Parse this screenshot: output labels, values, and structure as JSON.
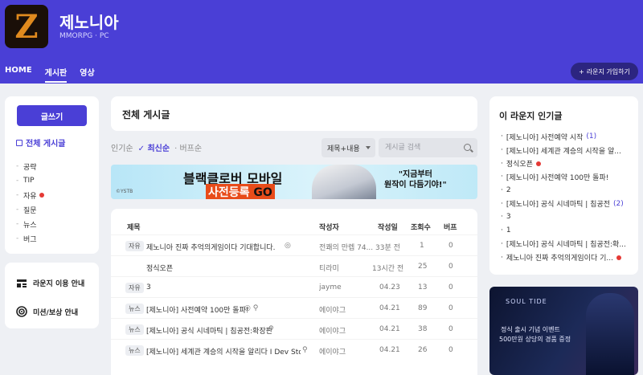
{
  "header": {
    "title": "제노니아",
    "subtitle": "MMORPG · PC",
    "logo_letter": "Z",
    "nav": [
      {
        "label": "HOME",
        "active": false
      },
      {
        "label": "게시판",
        "active": true
      },
      {
        "label": "영상",
        "active": false
      }
    ],
    "join_button": "라운지 가입하기",
    "join_icon": "+"
  },
  "sidebar": {
    "write_button": "글쓰기",
    "all_posts": "전체 게시글",
    "categories": [
      {
        "label": "공략",
        "new": false
      },
      {
        "label": "TIP",
        "new": false
      },
      {
        "label": "자유",
        "new": true
      },
      {
        "label": "질문",
        "new": false
      },
      {
        "label": "뉴스",
        "new": false
      },
      {
        "label": "버그",
        "new": false
      }
    ],
    "guides": [
      "라운지 이용 안내",
      "미션/보상 안내"
    ]
  },
  "main": {
    "title": "전체 게시글",
    "sort": {
      "popular": "인기순",
      "latest": "최신순",
      "recommended": "버프순",
      "active_check": "✓"
    },
    "search": {
      "filter": "제목+내용",
      "placeholder": "게시글 검색"
    },
    "banner": {
      "line1": "블랙클로버 모바일",
      "line2_a": "사전등록",
      "line2_b": "GO",
      "quote1": "\"지금부터",
      "quote2": "원작이 다듬기야!\"",
      "age": "©YSTB"
    },
    "table": {
      "headers": [
        "제목",
        "작성자",
        "작성일",
        "조회수",
        "버프"
      ],
      "rows": [
        {
          "tag": "자유",
          "title": "제노니아 진짜 추억의게임이다 기대합니다.",
          "author": "전쾌의 만렙 74...",
          "date": "33분 전",
          "views": "1",
          "buff": "0"
        },
        {
          "tag": "",
          "title": "정식오픈",
          "author": "티라미",
          "date": "13시간 전",
          "views": "25",
          "buff": "0"
        },
        {
          "tag": "자유",
          "title": "3",
          "author": "jayme",
          "date": "04.23",
          "views": "13",
          "buff": "0"
        },
        {
          "tag": "뉴스",
          "title": "[제노니아] 사전예약 100만 돌파!",
          "author": "에이야그",
          "date": "04.21",
          "views": "89",
          "buff": "0"
        },
        {
          "tag": "뉴스",
          "title": "[제노니아] 공식 시네마틱 | 침공전:확장판",
          "author": "에이야그",
          "date": "04.21",
          "views": "38",
          "buff": "0"
        },
        {
          "tag": "뉴스",
          "title": "[제노니아] 세계관 계승의 시작을 알리다 I Dev Story",
          "author": "에이야그",
          "date": "04.21",
          "views": "26",
          "buff": "0"
        }
      ]
    }
  },
  "popular": {
    "title": "이 라운지 인기글",
    "items": [
      {
        "label": "[제노니아] 사전예약 시작",
        "count": "(1)",
        "new": false
      },
      {
        "label": "[제노니아] 세계관 계승의 시작을 알...",
        "count": "",
        "new": false
      },
      {
        "label": "정식오픈",
        "count": "",
        "new": true
      },
      {
        "label": "[제노니아] 사전예약 100만 돌파!",
        "count": "",
        "new": false
      },
      {
        "label": "2",
        "count": "",
        "new": false
      },
      {
        "label": "[제노니아] 공식 시네마틱 | 침공전",
        "count": "(2)",
        "new": false
      },
      {
        "label": "3",
        "count": "",
        "new": false
      },
      {
        "label": "1",
        "count": "",
        "new": false
      },
      {
        "label": "[제노니아] 공식 시네마틱 | 침공전:확...",
        "count": "",
        "new": false
      },
      {
        "label": "제노니아 진짜 추억의게임이다 기...",
        "count": "",
        "new": true
      }
    ]
  },
  "ad": {
    "logo": "SOUL TIDE",
    "line1": "정식 출시 기념 이벤트",
    "line2": "500만원 상당의 경품 증정"
  },
  "colors": {
    "accent": "#4a3fd6",
    "header_bg": "#4a3fd6",
    "new_dot": "#e53935"
  }
}
